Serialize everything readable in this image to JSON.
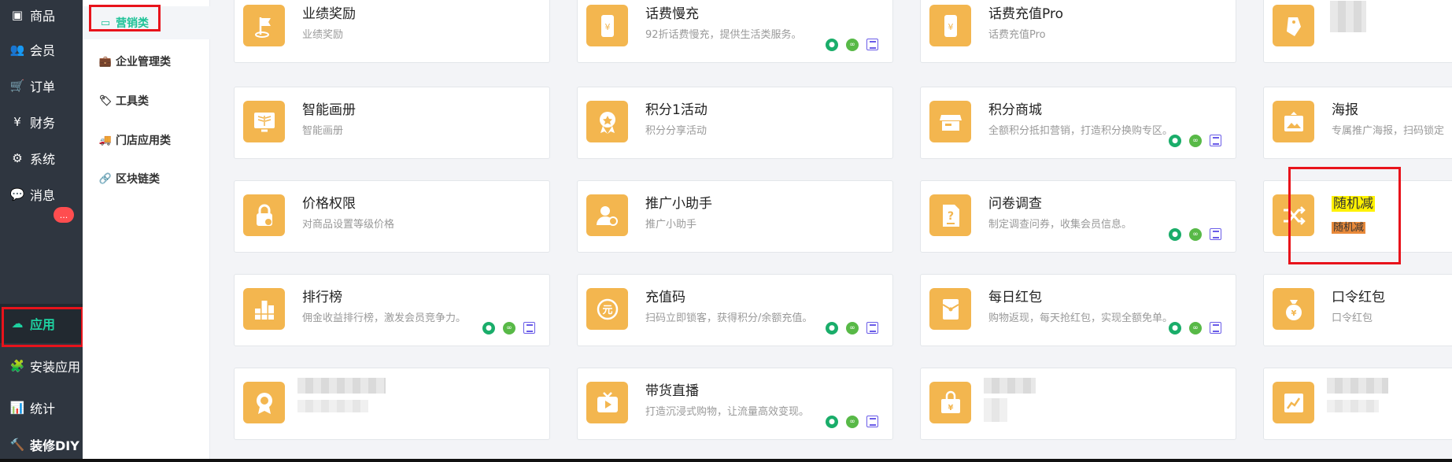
{
  "nav": {
    "items": [
      {
        "label": "商品",
        "icon": "box-icon"
      },
      {
        "label": "会员",
        "icon": "users-icon"
      },
      {
        "label": "订单",
        "icon": "cart-icon"
      },
      {
        "label": "财务",
        "icon": "yen-icon"
      },
      {
        "label": "系统",
        "icon": "gears-icon"
      },
      {
        "label": "消息",
        "icon": "chat-icon"
      },
      {
        "label": "应用",
        "icon": "cloud-icon"
      },
      {
        "label": "安装应用",
        "icon": "puzzle-icon"
      },
      {
        "label": "统计",
        "icon": "bar-chart-icon"
      },
      {
        "label": "装修DIY",
        "icon": "hammer-icon"
      }
    ],
    "message_badge": "...",
    "active": "应用"
  },
  "submenu": {
    "items": [
      {
        "label": "营销类",
        "icon": "money-icon"
      },
      {
        "label": "企业管理类",
        "icon": "briefcase-icon"
      },
      {
        "label": "工具类",
        "icon": "tags-icon"
      },
      {
        "label": "门店应用类",
        "icon": "truck-icon"
      },
      {
        "label": "区块链类",
        "icon": "link-icon"
      }
    ],
    "active": "营销类"
  },
  "cards": {
    "r0c0": {
      "title": "业绩奖励",
      "desc": "业绩奖励",
      "icon": "flag-icon"
    },
    "r0c1": {
      "title": "话费慢充",
      "desc": "92折话费慢充，提供生活类服务。",
      "icon": "phone-yen-icon"
    },
    "r0c2": {
      "title": "话费充值Pro",
      "desc": "话费充值Pro",
      "icon": "phone-yen-icon"
    },
    "r0c3": {
      "title": "",
      "desc": "",
      "icon": "tag-icon"
    },
    "r1c0": {
      "title": "智能画册",
      "desc": "智能画册",
      "icon": "album-icon"
    },
    "r1c1": {
      "title": "积分1活动",
      "desc": "积分分享活动",
      "icon": "medal-icon"
    },
    "r1c2": {
      "title": "积分商城",
      "desc": "全额积分抵扣营销，打造积分换购专区。",
      "icon": "shop-icon"
    },
    "r1c3": {
      "title": "海报",
      "desc": "专属推广海报，扫码锁定",
      "icon": "poster-icon"
    },
    "r2c0": {
      "title": "价格权限",
      "desc": "对商品设置等级价格",
      "icon": "lock-icon"
    },
    "r2c1": {
      "title": "推广小助手",
      "desc": "推广小助手",
      "icon": "user-promo-icon"
    },
    "r2c2": {
      "title": "问卷调查",
      "desc": "制定调查问券，收集会员信息。",
      "icon": "question-doc-icon"
    },
    "r2c3": {
      "title": "随机减",
      "desc": "随机减",
      "icon": "shuffle-icon"
    },
    "r3c0": {
      "title": "排行榜",
      "desc": "佣金收益排行榜，激发会员竞争力。",
      "icon": "ranking-icon"
    },
    "r3c1": {
      "title": "充值码",
      "desc": "扫码立即锁客，获得积分/余额充值。",
      "icon": "yuan-icon"
    },
    "r3c2": {
      "title": "每日红包",
      "desc": "购物返现，每天抢红包，实现全额免单。",
      "icon": "envelope-icon"
    },
    "r3c3": {
      "title": "口令红包",
      "desc": "口令红包",
      "icon": "money-bag-icon"
    },
    "r4c0": {
      "title": "",
      "desc": "",
      "icon": "award-icon"
    },
    "r4c1": {
      "title": "带货直播",
      "desc": "打造沉浸式购物，让流量高效变现。",
      "icon": "live-tv-icon"
    },
    "r4c2": {
      "title": "",
      "desc": "",
      "icon": "yen-bag-icon"
    },
    "r4c3": {
      "title": "",
      "desc": "",
      "icon": "chart-icon"
    }
  },
  "colors": {
    "accent": "#1ed0a0",
    "icon_bg": "#f3b64f",
    "highlight_box": "#e8131b",
    "highlight_title": "#fff200",
    "highlight_desc": "#e8893a"
  }
}
